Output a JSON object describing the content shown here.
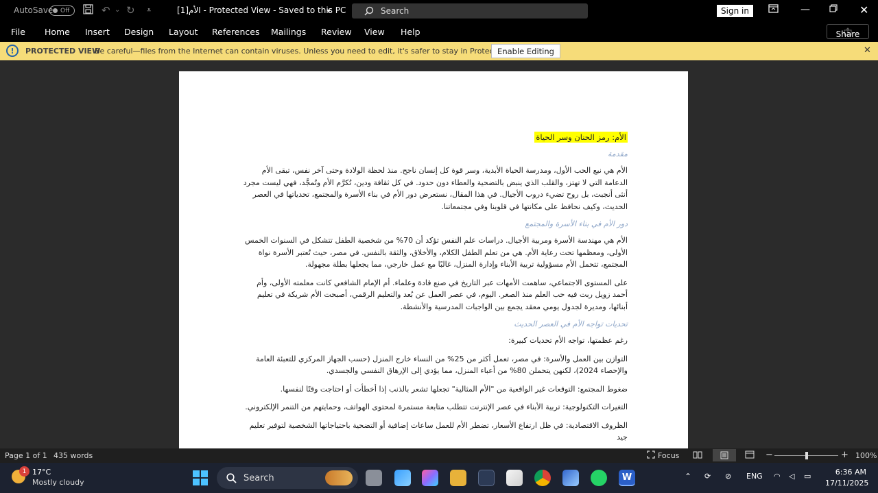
{
  "titlebar": {
    "autosave_label": "AutoSave",
    "autosave_state": "Off",
    "doc_title": "الأم[1]  -  Protected View  -  Saved to this PC",
    "search_label": "Search",
    "signin_label": "Sign in"
  },
  "menu": {
    "items": [
      "File",
      "Home",
      "Insert",
      "Design",
      "Layout",
      "References",
      "Mailings",
      "Review",
      "View",
      "Help"
    ],
    "share_label": "Share"
  },
  "protected_view": {
    "label": "PROTECTED VIEW",
    "message": "Be careful—files from the Internet can contain viruses. Unless you need to edit, it's safer to stay in Protected View.",
    "button_label": "Enable Editing"
  },
  "document": {
    "title": "الأم: رمز الحنان وسر الحياة",
    "blocks": [
      {
        "type": "heading",
        "text": "مقدمة"
      },
      {
        "type": "para",
        "text": "الأم هي نبع الحب الأول، ومدرسة الحياة الأبدية، وسر قوة كل إنسان ناجح. منذ لحظة الولادة وحتى آخر نفس، تبقى الأم الدعامة التي لا تهتز، والقلب الذي ينبض بالتضحية والعطاء دون حدود. في كل ثقافة ودين، تُكرَّم الأم وتُمجَّد، فهي ليست مجرد أنثى أنجبت، بل روح تضيء دروب الأجيال. في هذا المقال، نستعرض دور الأم في بناء الأسرة والمجتمع، تحدياتها في العصر الحديث، وكيف نحافظ على مكانتها في قلوبنا وفي مجتمعاتنا."
      },
      {
        "type": "heading",
        "text": "دور الأم في بناء الأسرة والمجتمع"
      },
      {
        "type": "para",
        "text": "الأم هي مهندسة الأسرة ومربية الأجيال. دراسات علم النفس تؤكد أن 70% من شخصية الطفل تتشكل في السنوات الخمس الأولى، ومعظمها تحت رعاية الأم. هي من تعلم الطفل الكلام، والأخلاق، والثقة بالنفس. في مصر، حيث تُعتبر الأسرة نواة المجتمع، تتحمل الأم مسؤولية تربية الأبناء وإدارة المنزل، غالبًا مع عمل خارجي، مما يجعلها بطلة مجهولة."
      },
      {
        "type": "para",
        "text": "على المستوى الاجتماعي، ساهمت الأمهات عبر التاريخ في صنع قادة وعلماء. أم الإمام الشافعي كانت معلمته الأولى، وأم أحمد زويل ربت فيه حب العلم منذ الصغر. اليوم، في عصر العمل عن بُعد والتعليم الرقمي، أصبحت الأم شريكة في تعليم أبنائها، ومديرة لجدول يومي معقد يجمع بين الواجبات المدرسية والأنشطة."
      },
      {
        "type": "heading",
        "text": "تحديات تواجه الأم في العصر الحديث"
      },
      {
        "type": "para",
        "text": "رغم عظمتها، تواجه الأم تحديات كبيرة:"
      },
      {
        "type": "para",
        "text": "التوازن بين العمل والأسرة: في مصر، تعمل أكثر من 25% من النساء خارج المنزل (حسب الجهاز المركزي للتعبئة العامة والإحصاء 2024)، لكنهن يتحملن 80% من أعباء المنزل، مما يؤدي إلى الإرهاق النفسي والجسدي."
      },
      {
        "type": "para",
        "text": "ضغوط المجتمع: التوقعات غير الواقعية من \"الأم المثالية\" تجعلها تشعر بالذنب إذا أخطأت أو احتاجت وقتًا لنفسها."
      },
      {
        "type": "para",
        "text": "التغيرات التكنولوجية: تربية الأبناء في عصر الإنترنت تتطلب متابعة مستمرة لمحتوى الهواتف، وحمايتهم من التنمر الإلكتروني."
      },
      {
        "type": "para",
        "text": "الظروف الاقتصادية: في ظل ارتفاع الأسعار، تضطر الأم للعمل ساعات إضافية أو التضحية باحتياجاتها الشخصية لتوفير تعليم جيد"
      }
    ]
  },
  "status": {
    "page": "Page 1 of 1",
    "words": "435 words",
    "focus": "Focus",
    "zoom": "100%",
    "zoom_level": 100
  },
  "taskbar": {
    "temperature": "17°C",
    "condition": "Mostly cloudy",
    "badge": "1",
    "search_label": "Search",
    "language": "ENG",
    "time": "6:36 AM",
    "date": "17/11/2025"
  },
  "colors": {
    "accent_blue": "#2563a8",
    "pv_bar": "#f6dc79",
    "highlight": "#ffff00",
    "heading": "#8ea6c8"
  }
}
